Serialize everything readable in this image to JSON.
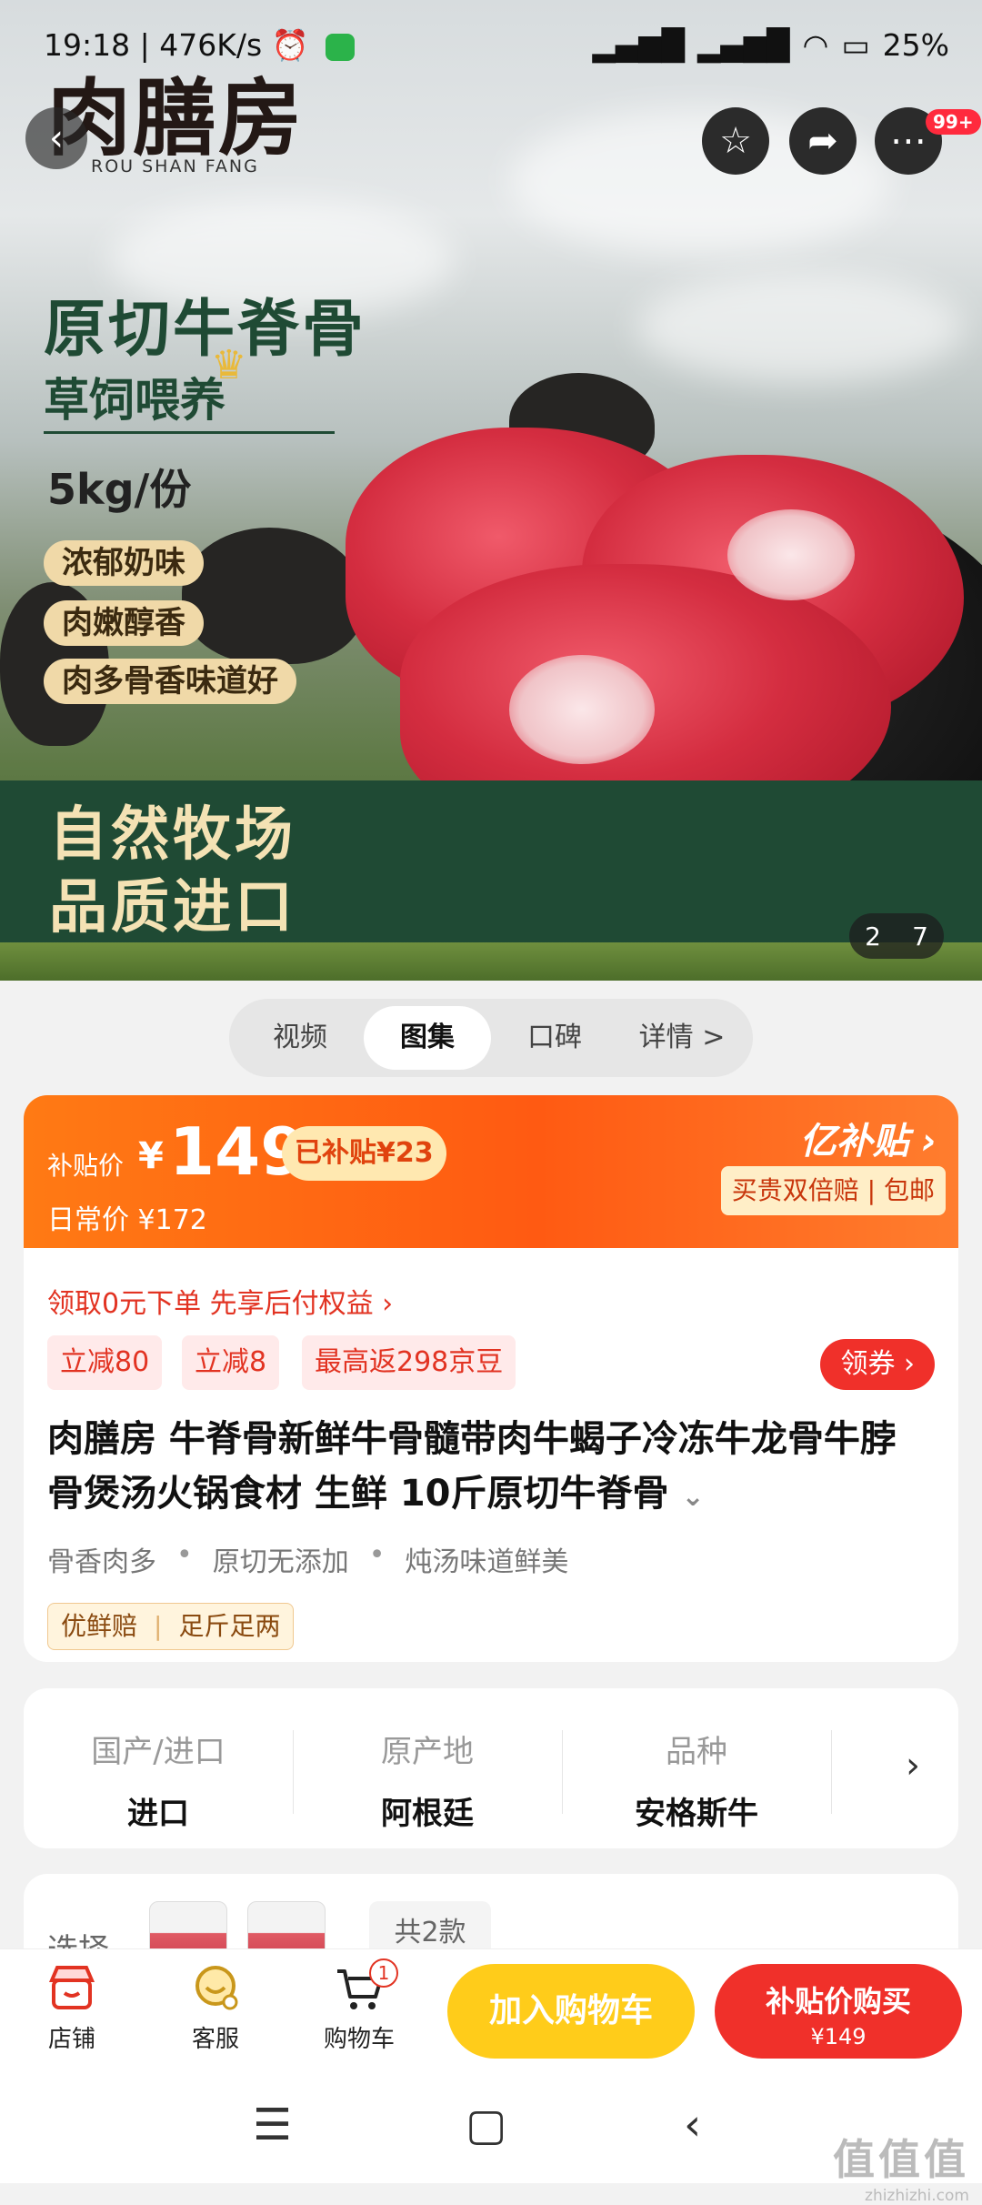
{
  "status_bar": {
    "time": "19:18",
    "speed": "476K/s",
    "battery": "25%"
  },
  "hero": {
    "brand": "肉膳房",
    "brand_sub": "ROU SHAN FANG",
    "title": "原切牛脊骨",
    "subtitle": "草饲喂养",
    "weight": "5kg/份",
    "features": [
      "浓郁奶味",
      "肉嫩醇香",
      "肉多骨香味道好"
    ],
    "band_line1": "自然牧场",
    "band_line2": "品质进口",
    "pager_current": "2",
    "pager_total": "7",
    "more_badge": "99+"
  },
  "media_tabs": [
    "视频",
    "图集",
    "口碑",
    "详情 >"
  ],
  "price": {
    "subsidy_label": "补贴价",
    "currency": "¥",
    "subsidy_price": "149",
    "subsidy_saved": "已补贴¥23",
    "daily_label": "日常价 ¥172",
    "program_name": "亿补贴",
    "program_desc": "买贵双倍赔 | 包邮"
  },
  "product": {
    "pay_later": "领取0元下单 先享后付权益 ›",
    "discounts": [
      "立减80",
      "立减8",
      "最高返298京豆"
    ],
    "get_coupon": "领券 ›",
    "title": "肉膳房 牛脊骨新鲜牛骨髓带肉牛蝎子冷冻牛龙骨牛脖骨煲汤火锅食材 生鲜 10斤原切牛脊骨",
    "selling_points": [
      "骨香肉多",
      "原切无添加",
      "炖汤味道鲜美"
    ],
    "guarantees": [
      "优鲜赔",
      "足斤足两"
    ]
  },
  "attributes": [
    {
      "key": "国产/进口",
      "value": "进口"
    },
    {
      "key": "原产地",
      "value": "阿根廷"
    },
    {
      "key": "品种",
      "value": "安格斯牛"
    }
  ],
  "selection": {
    "label": "选择",
    "count": "共2款"
  },
  "bottom_bar": {
    "store": "店铺",
    "service": "客服",
    "cart": "购物车",
    "cart_count": "1",
    "add_to_cart": "加入购物车",
    "buy_label": "补贴价购买",
    "buy_price": "¥149"
  },
  "watermark": {
    "main": "值值值",
    "sub": "zhizhizhi.com"
  }
}
